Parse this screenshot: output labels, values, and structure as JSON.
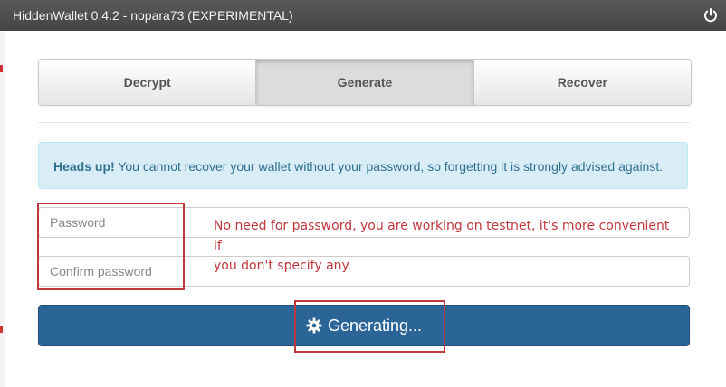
{
  "window": {
    "title": "HiddenWallet 0.4.2 - nopara73 (EXPERIMENTAL)"
  },
  "tabs": [
    {
      "label": "Decrypt",
      "active": false
    },
    {
      "label": "Generate",
      "active": true
    },
    {
      "label": "Recover",
      "active": false
    }
  ],
  "alert": {
    "heading": "Heads up!",
    "message": " You cannot recover your wallet without your password, so forgetting it is strongly advised against."
  },
  "form": {
    "password_placeholder": "Password",
    "confirm_password_placeholder": "Confirm password",
    "submit_label": "Generating..."
  },
  "annotation": {
    "note_line1": "No need for password, you are working on testnet, it's more convenient if",
    "note_line2": "you don't specify any.",
    "color": "#c0383c"
  },
  "colors": {
    "primary": "#2b6496",
    "alert_bg": "#d9edf7",
    "alert_text": "#31708f",
    "titlebar": "#4a4a4a"
  }
}
